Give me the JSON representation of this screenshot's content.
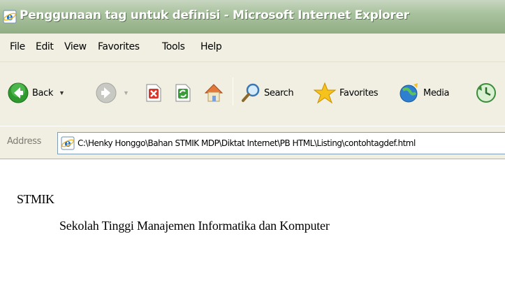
{
  "window": {
    "title": "Penggunaan tag untuk definisi - Microsoft Internet Explorer",
    "icon": "ie-icon"
  },
  "menubar": {
    "items": [
      "File",
      "Edit",
      "View",
      "Favorites",
      "Tools",
      "Help"
    ]
  },
  "toolbar": {
    "back_label": "Back",
    "search_label": "Search",
    "favorites_label": "Favorites",
    "media_label": "Media",
    "icons": [
      "back-icon",
      "forward-icon",
      "stop-icon",
      "refresh-icon",
      "home-icon",
      "search-icon",
      "favorites-icon",
      "media-icon",
      "history-icon"
    ]
  },
  "address": {
    "label": "Address",
    "url": "C:\\Henky Honggo\\Bahan STMIK MDP\\Diktat Internet\\PB HTML\\Listing\\contohtagdef.html"
  },
  "content": {
    "term": "STMIK",
    "definition": "Sekolah Tinggi Manajemen Informatika dan Komputer"
  },
  "colors": {
    "titlebar": "#a9c29e",
    "chrome": "#f1efe2",
    "back_green": "#2f9b2f",
    "stop_red": "#d8362b"
  }
}
